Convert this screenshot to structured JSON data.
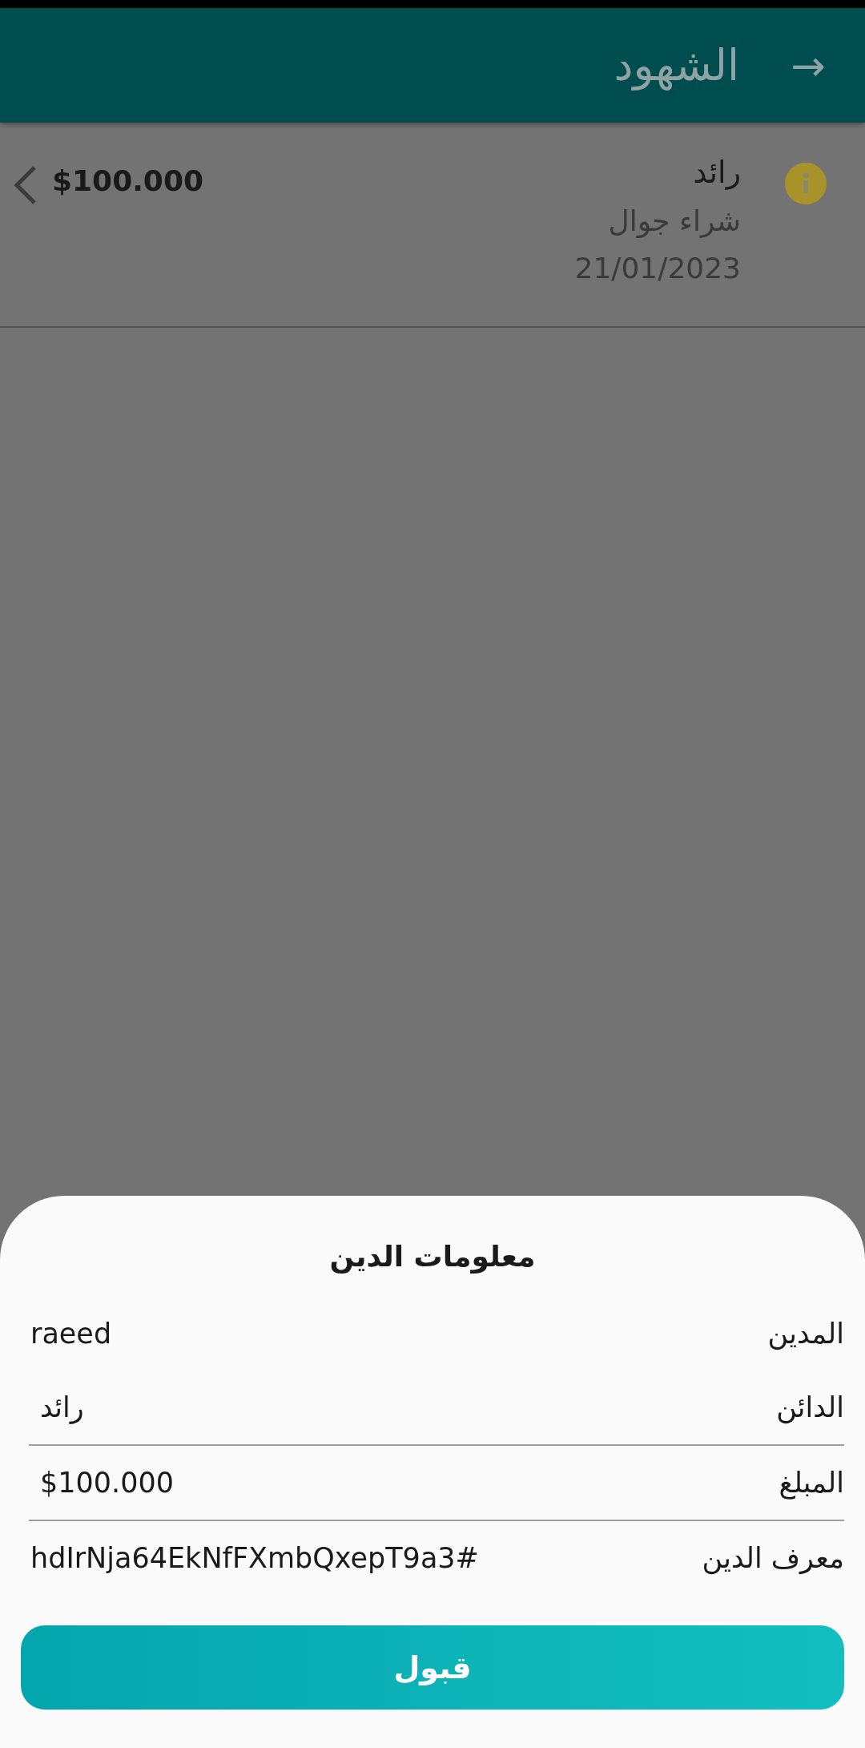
{
  "app_bar": {
    "title": "الشهود",
    "back_icon": "→"
  },
  "debts": [
    {
      "name": "رائد",
      "description": "شراء جوال",
      "date": "21/01/2023",
      "amount": "$100.000"
    }
  ],
  "sheet": {
    "title": "معلومات الدين",
    "rows": [
      {
        "label": "المدين",
        "value": "raeed",
        "divider": false
      },
      {
        "label": "الدائن",
        "value": "رائد",
        "divider": true
      },
      {
        "label": "المبلغ",
        "value": "$100.000",
        "divider": true
      },
      {
        "label": "معرف الدين",
        "value": "hdIrNja64EkNfFXmbQxepT9a3#",
        "divider": false
      }
    ],
    "button": "قبول"
  }
}
